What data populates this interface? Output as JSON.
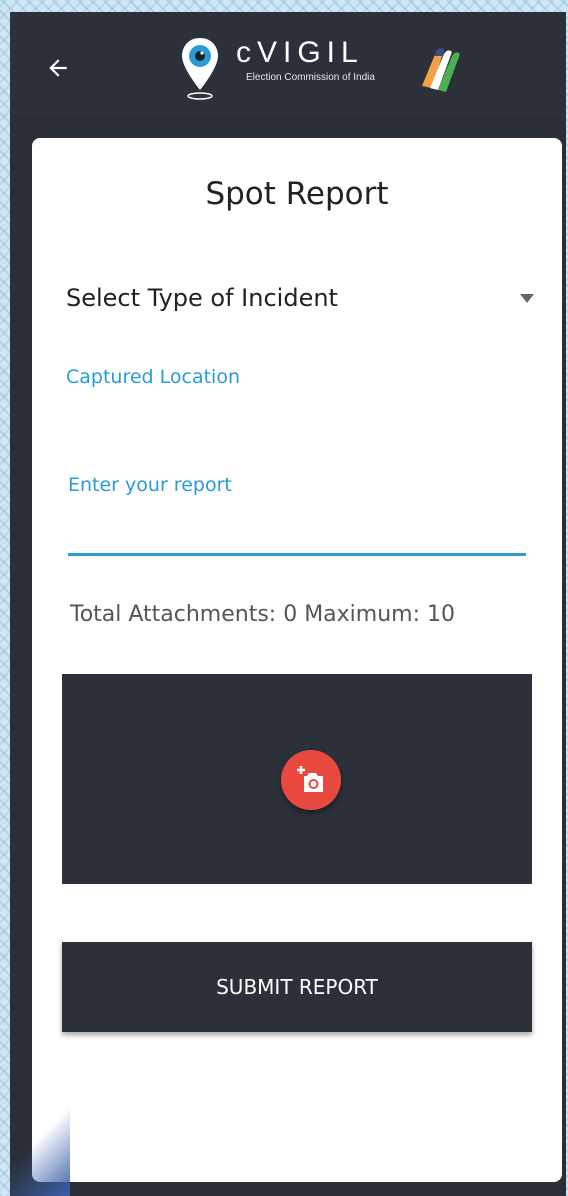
{
  "app": {
    "name": "cVIGIL",
    "subtitle": "Election Commission of India",
    "back_icon": "arrow-left-icon",
    "pin_icon": "map-pin-eye-icon",
    "ink_icon": "indelible-ink-finger-icon"
  },
  "page": {
    "title": "Spot Report"
  },
  "form": {
    "incident_select_label": "Select Type of Incident",
    "captured_location_label": "Captured Location",
    "report_label": "Enter your report",
    "report_value": "",
    "attachments_text": "Total Attachments: 0 Maximum: 10",
    "add_photo_icon": "add-photo-camera-icon",
    "submit_label": "SUBMIT REPORT"
  },
  "colors": {
    "appbar": "#2b3039",
    "accent_blue": "#2a9bd6",
    "fab_red": "#e9483f",
    "card": "#ffffff"
  }
}
